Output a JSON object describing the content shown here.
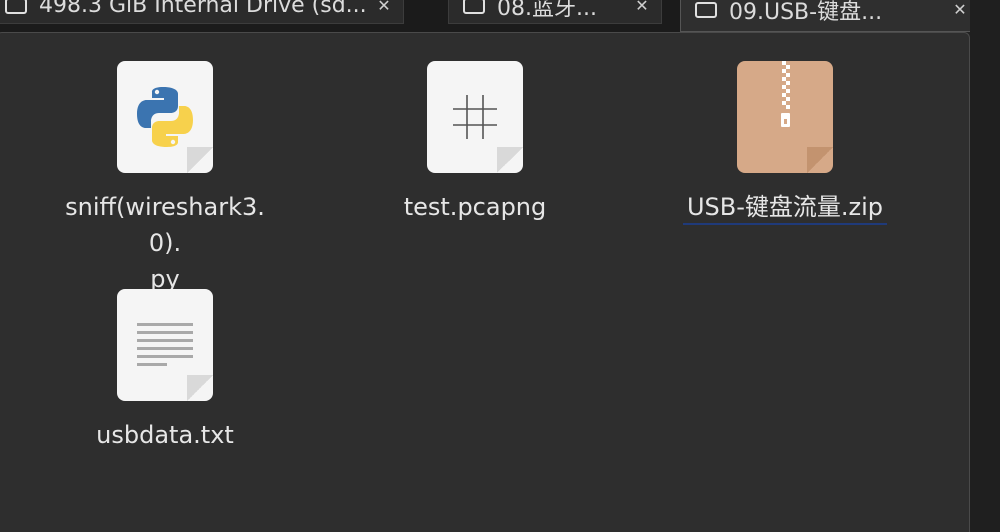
{
  "tabs": [
    {
      "label": "498.3 GiB Internal Drive (sd...",
      "close": "✕"
    },
    {
      "label": "08.蓝牙...",
      "close": "✕"
    },
    {
      "label": "09.USB-键盘...",
      "close": "✕"
    }
  ],
  "files": [
    {
      "name_line1": "sniff(wireshark3.0).",
      "name_line2": "py",
      "icon": "python-icon"
    },
    {
      "name_line1": "test.pcapng",
      "name_line2": "",
      "icon": "hash-grid-icon"
    },
    {
      "name_line1": "USB-键盘流量.zip",
      "name_line2": "",
      "icon": "zip-archive-icon"
    },
    {
      "name_line1": "usbdata.txt",
      "name_line2": "",
      "icon": "text-document-icon"
    }
  ],
  "colors": {
    "background": "#2e2e2e",
    "zip_thumb": "#d6a988",
    "doc_thumb": "#f5f5f5",
    "python_blue": "#3b74b0",
    "python_yellow": "#f7d14c",
    "selection_underline": "#1f3a7a"
  }
}
